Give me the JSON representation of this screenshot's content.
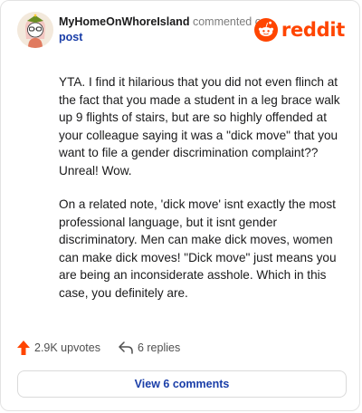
{
  "comment": {
    "author": "MyHomeOnWhoreIsland",
    "action_text": "commented on",
    "target_text": "post",
    "brand_word": "reddit",
    "paragraphs": [
      "YTA. I find it hilarious that you did not even flinch at the fact that you made a student in a leg brace walk up 9 flights of stairs, but are so highly offended at your colleague saying it was a \"dick move\" that you want to file a gender discrimination complaint?? Unreal! Wow.",
      "On a related note, 'dick move' isnt exactly the most professional language, but it isnt gender discriminatory. Men can make dick moves, women can make dick moves! \"Dick move\" just means you are being an inconsiderate asshole. Which in this case, you definitely are."
    ],
    "upvotes_text": "2.9K upvotes",
    "replies_text": "6 replies",
    "view_button_label": "View 6 comments"
  },
  "icons": {
    "avatar": "snoo-avatar-icon",
    "brand": "reddit-snoo-logo-icon",
    "upvote": "upvote-arrow-icon",
    "reply": "reply-arrow-icon"
  },
  "colors": {
    "brand_orange": "#ff4500",
    "link_blue": "#1a3ea8",
    "meta_gray": "#7c7c7c",
    "border": "#e3e3e3"
  }
}
